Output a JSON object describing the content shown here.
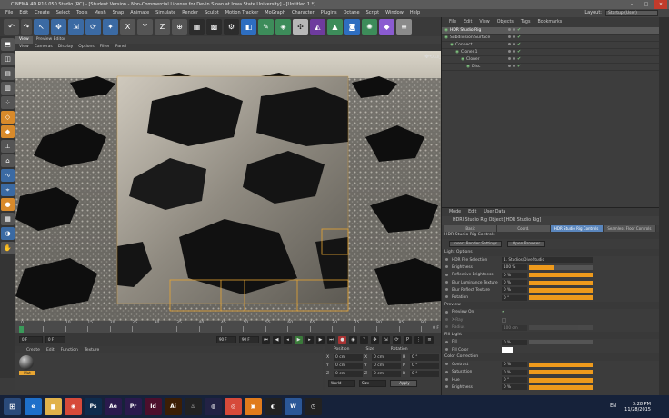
{
  "titlebar": {
    "title": "CINEMA 4D R16.050 Studio (RC) - [Student Version - Non-Commercial License for Devin Sloan at Iowa State University] - [Untitled 1 *]",
    "minimize": "–",
    "maximize": "□",
    "close": "✕"
  },
  "menubar": {
    "items": [
      "File",
      "Edit",
      "Create",
      "Select",
      "Tools",
      "Mesh",
      "Snap",
      "Animate",
      "Simulate",
      "Render",
      "Sculpt",
      "Motion Tracker",
      "MoGraph",
      "Character",
      "Plugins",
      "Octane",
      "Script",
      "Window",
      "Help"
    ],
    "layout_label": "Layout:",
    "layout_value": "Startup (User)"
  },
  "viewport": {
    "tabs": [
      "View",
      "Preview Editor"
    ],
    "menu": [
      "View",
      "Cameras",
      "Display",
      "Options",
      "Filter",
      "Panel"
    ]
  },
  "timeline": {
    "ticks": [
      "0",
      "5",
      "10",
      "15",
      "20",
      "25",
      "30",
      "35",
      "40",
      "45",
      "50",
      "55",
      "60",
      "65",
      "70",
      "75",
      "80",
      "85",
      "90"
    ],
    "end_frame": "0 F"
  },
  "playbar": {
    "start": "0 F",
    "current": "0 F",
    "end": "90 F",
    "end2": "90 F"
  },
  "material": {
    "menu": [
      "Create",
      "Edit",
      "Function",
      "Texture"
    ],
    "swatch_label": "Mat"
  },
  "coords": {
    "headers": [
      "Position",
      "Size",
      "Rotation"
    ],
    "rows": [
      {
        "a": "X",
        "pos": "0 cm",
        "b": "X",
        "size": "0 cm",
        "c": "H",
        "rot": "0 °"
      },
      {
        "a": "Y",
        "pos": "0 cm",
        "b": "Y",
        "size": "0 cm",
        "c": "P",
        "rot": "0 °"
      },
      {
        "a": "Z",
        "pos": "0 cm",
        "b": "Z",
        "size": "0 cm",
        "c": "B",
        "rot": "0 °"
      }
    ],
    "mode": "World",
    "size_mode": "Size",
    "apply": "Apply"
  },
  "objmgr": {
    "menu": [
      "File",
      "Edit",
      "View",
      "Objects",
      "Tags",
      "Bookmarks"
    ],
    "objects": [
      {
        "name": "HDR Studio Rig",
        "indent": 0,
        "selected": true
      },
      {
        "name": "Subdivision Surface",
        "indent": 0,
        "selected": false
      },
      {
        "name": "Connect",
        "indent": 1,
        "selected": false
      },
      {
        "name": "Cloner.1",
        "indent": 2,
        "selected": false
      },
      {
        "name": "Cloner",
        "indent": 3,
        "selected": false
      },
      {
        "name": "Disc",
        "indent": 4,
        "selected": false
      }
    ]
  },
  "attrmgr": {
    "menu": [
      "Mode",
      "Edit",
      "User Data"
    ],
    "title": "HDRI Studio Rig Object [HDR Studio Rig]",
    "tabs": [
      "Basic",
      "Coord.",
      "HDR Studio Rig Controls",
      "Seamless Floor Controls"
    ],
    "active_tab": 2,
    "section_controls": "HDR Studio Rig Controls",
    "btn_insert": "Insert Render Settings",
    "btn_open": "Open Browser",
    "section_light": "Light Options",
    "props_light": [
      {
        "label": "HDR File Selection",
        "value": "1. Studios/DiveStudio",
        "fill": null
      },
      {
        "label": "Brightness",
        "value": "100 %",
        "fill": 0.4
      },
      {
        "label": "Reflective Brightness",
        "value": "0 %",
        "fill": 1.0
      },
      {
        "label": "Blur Luminance Texture",
        "value": "0 %",
        "fill": 1.0
      },
      {
        "label": "Blur Reflect Texture",
        "value": "0 %",
        "fill": 1.0
      },
      {
        "label": "Rotation",
        "value": "0 °",
        "fill": 1.0
      }
    ],
    "section_preview": "Preview",
    "preview_on": "Preview On",
    "xray": "X-Ray",
    "radius_label": "Radius",
    "radius_value": "100 cm",
    "section_fill": "Fill Light",
    "fill_label": "Fill",
    "fill_value": "0 %",
    "fill_color": "Fill Color",
    "section_cc": "Color Correction",
    "props_cc": [
      {
        "label": "Contrast",
        "value": "0 %",
        "fill": 1.0
      },
      {
        "label": "Saturation",
        "value": "0 %",
        "fill": 1.0
      },
      {
        "label": "Hue",
        "value": "0 °",
        "fill": 1.0
      },
      {
        "label": "Brightness",
        "value": "0 %",
        "fill": 1.0
      }
    ]
  },
  "taskbar": {
    "apps": [
      {
        "name": "ie-icon",
        "color": "#1e6fc9",
        "label": "e"
      },
      {
        "name": "folder-icon",
        "color": "#e1b24a",
        "label": "▆"
      },
      {
        "name": "chrome-icon",
        "color": "#d64a3a",
        "label": "◉"
      },
      {
        "name": "photoshop-icon",
        "color": "#0f2c4d",
        "label": "Ps"
      },
      {
        "name": "after-effects-icon",
        "color": "#2a1a4d",
        "label": "Ae"
      },
      {
        "name": "premiere-icon",
        "color": "#2a1a4d",
        "label": "Pr"
      },
      {
        "name": "indesign-icon",
        "color": "#4d0f2c",
        "label": "Id"
      },
      {
        "name": "illustrator-icon",
        "color": "#3b1e05",
        "label": "Ai"
      },
      {
        "name": "steam-icon",
        "color": "#222",
        "label": "♨"
      },
      {
        "name": "cinema4d-icon",
        "color": "#224",
        "label": "◍"
      },
      {
        "name": "chrome2-icon",
        "color": "#d64a3a",
        "label": "◎"
      },
      {
        "name": "photos-icon",
        "color": "#e07b1c",
        "label": "▣"
      },
      {
        "name": "media-icon",
        "color": "#222",
        "label": "◐"
      },
      {
        "name": "word-icon",
        "color": "#2b5797",
        "label": "W"
      },
      {
        "name": "app-icon",
        "color": "#222",
        "label": "◷"
      }
    ],
    "lang": "EN",
    "time": "3:28 PM",
    "date": "11/28/2015"
  }
}
